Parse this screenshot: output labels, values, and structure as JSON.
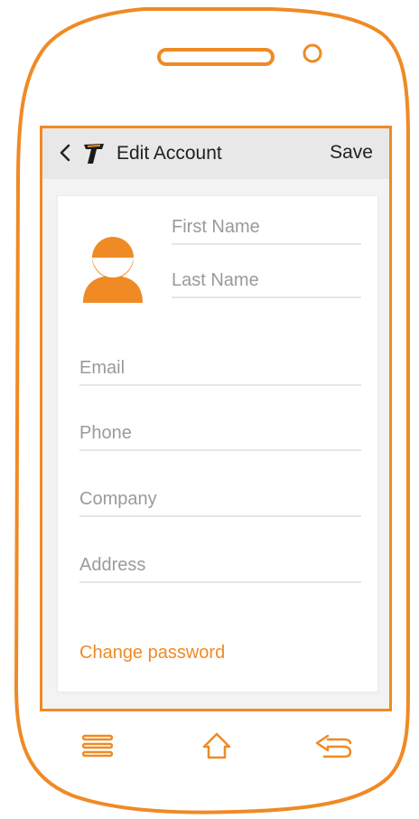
{
  "colors": {
    "accent": "#F08A24",
    "header_bg": "#E8E8E9",
    "placeholder": "#9A9A9A"
  },
  "header": {
    "back_icon": "chevron-left-icon",
    "logo_icon": "app-logo-icon",
    "title": "Edit Account",
    "save_label": "Save"
  },
  "profile": {
    "avatar_icon": "user-avatar-icon",
    "first_name_placeholder": "First Name",
    "last_name_placeholder": "Last Name"
  },
  "form": {
    "email_placeholder": "Email",
    "phone_placeholder": "Phone",
    "company_placeholder": "Company",
    "address_placeholder": "Address"
  },
  "links": {
    "change_password": "Change password"
  },
  "navbar": {
    "menu_icon": "menu-icon",
    "home_icon": "home-icon",
    "back_icon": "back-arrow-icon"
  }
}
